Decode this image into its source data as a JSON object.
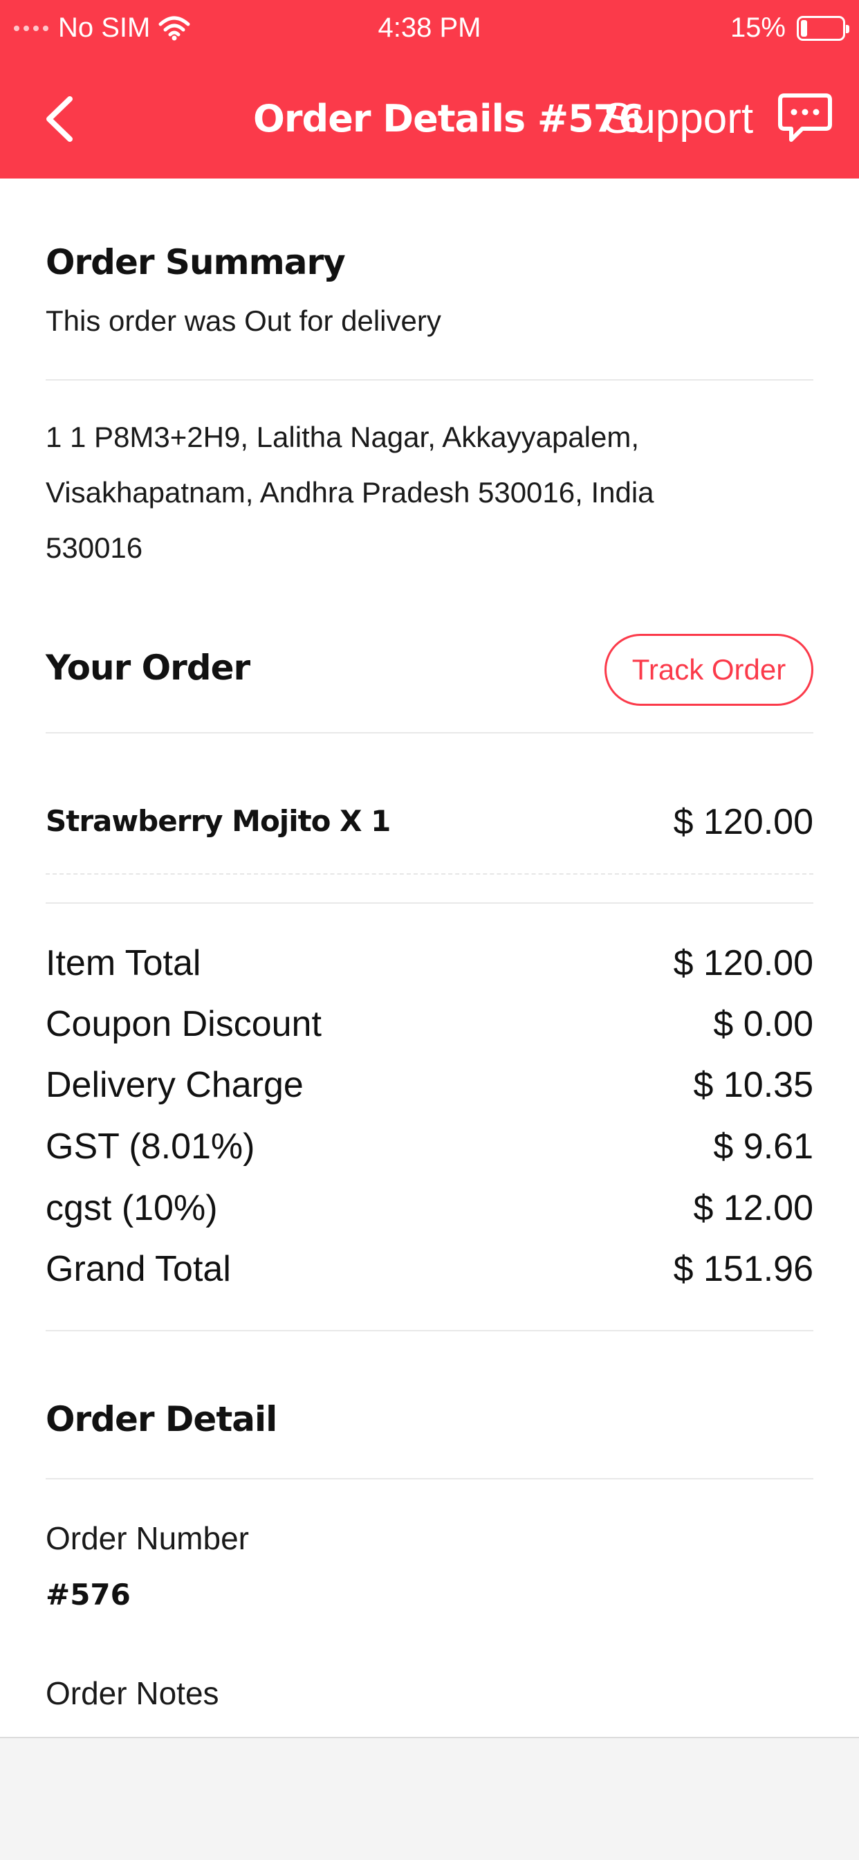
{
  "status_bar": {
    "carrier": "No SIM",
    "time": "4:38 PM",
    "battery": "15%",
    "battery_level": 0.15
  },
  "nav": {
    "title": "Order Details #576",
    "support_label": "Support",
    "back_icon": "chevron-left-icon",
    "chat_icon": "chat-bubble-icon"
  },
  "order_summary": {
    "title": "Order Summary",
    "status_text": "This order was Out for delivery"
  },
  "address": {
    "line1": "1 1 P8M3+2H9, Lalitha Nagar, Akkayyapalem,",
    "line2": "Visakhapatnam, Andhra Pradesh 530016, India",
    "line3": "530016"
  },
  "your_order": {
    "title": "Your Order",
    "track_button_label": "Track Order",
    "items": [
      {
        "name": "Strawberry Mojito X 1",
        "price": "$ 120.00"
      }
    ]
  },
  "bill": {
    "rows": [
      {
        "label": "Item Total",
        "value": "$ 120.00"
      },
      {
        "label": "Coupon Discount",
        "value": "$ 0.00"
      },
      {
        "label": "Delivery Charge",
        "value": "$ 10.35"
      },
      {
        "label": "GST (8.01%)",
        "value": "$ 9.61"
      },
      {
        "label": "cgst (10%)",
        "value": "$ 12.00"
      },
      {
        "label": "Grand Total",
        "value": "$ 151.96"
      }
    ]
  },
  "order_detail": {
    "title": "Order Detail",
    "order_number_label": "Order Number",
    "order_number_value": "#576",
    "order_notes_label": "Order Notes"
  },
  "colors": {
    "accent": "#fb3a4a",
    "background": "#ffffff",
    "divider": "#e8e8e8"
  }
}
